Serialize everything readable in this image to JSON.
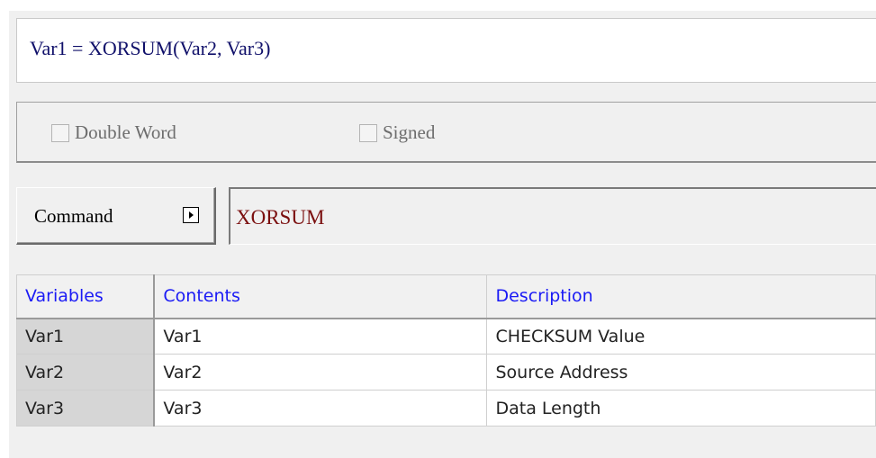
{
  "formula": "Var1 = XORSUM(Var2, Var3)",
  "options": {
    "double_word": {
      "label": "Double Word",
      "checked": false,
      "enabled": false
    },
    "signed": {
      "label": "Signed",
      "checked": false,
      "enabled": false
    }
  },
  "command": {
    "button_label": "Command",
    "value": "XORSUM",
    "value_color": "#7b1010"
  },
  "table": {
    "headers": [
      "Variables",
      "Contents",
      "Description"
    ],
    "header_color": "#1b1bf5",
    "rows": [
      {
        "variable": "Var1",
        "contents": "Var1",
        "description": "CHECKSUM Value"
      },
      {
        "variable": "Var2",
        "contents": "Var2",
        "description": "Source Address"
      },
      {
        "variable": "Var3",
        "contents": "Var3",
        "description": "Data Length"
      }
    ]
  }
}
